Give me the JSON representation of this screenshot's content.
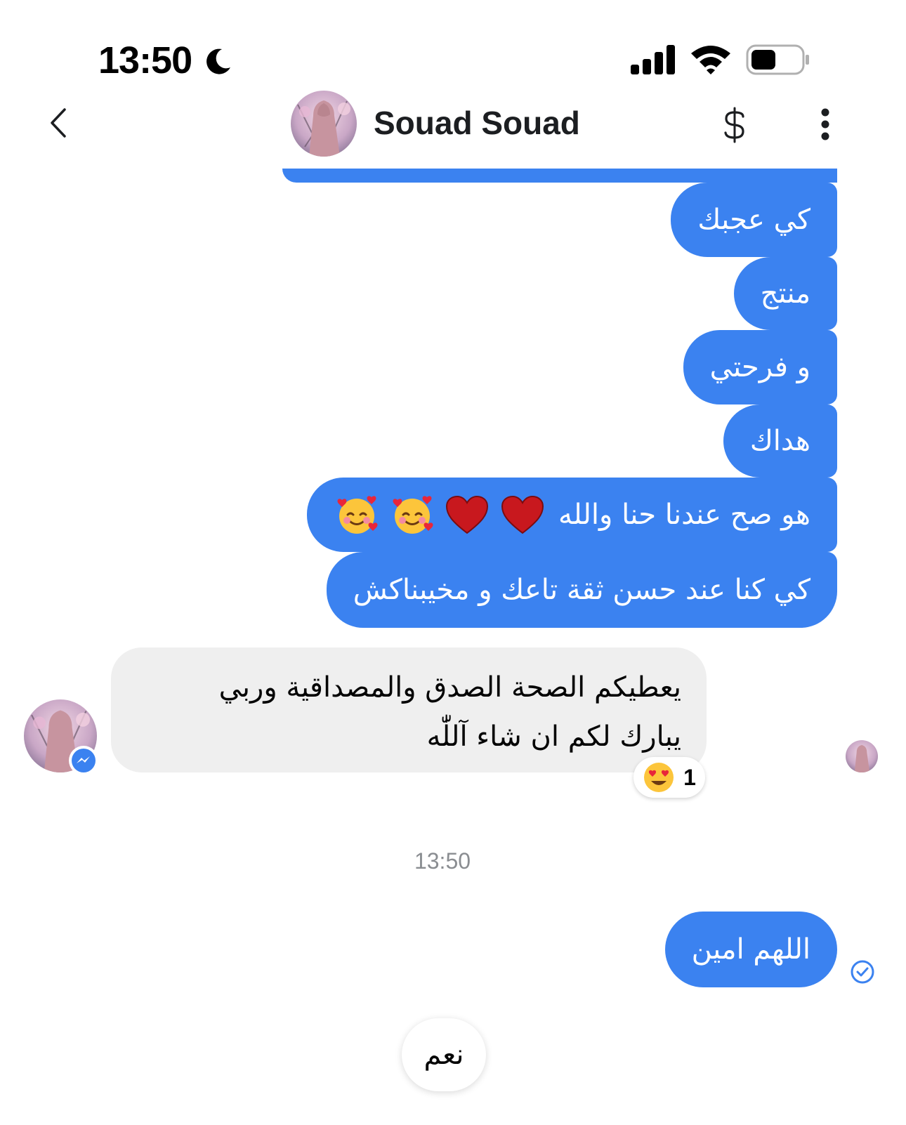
{
  "status_bar": {
    "time": "13:50",
    "icons": [
      "moon-icon",
      "signal-icon",
      "wifi-icon",
      "battery-icon"
    ]
  },
  "header": {
    "contact_name": "Souad Souad",
    "icons": [
      "back-chevron-icon",
      "contact-avatar",
      "dollar-icon",
      "more-vertical-icon"
    ]
  },
  "messages": {
    "outgoing": [
      "كي عجبك",
      "منتج",
      "و فرحتي",
      "هداك",
      "هو صح عندنا حنا والله",
      "كي كنا عند حسن ثقة تاعك و مخيبناكش"
    ],
    "outgoing_emojis": [
      "heart-emoji",
      "heart-emoji",
      "smiling-face-with-hearts-emoji",
      "smiling-face-with-hearts-emoji"
    ],
    "incoming": {
      "line1": "يعطيكم الصحة الصدق والمصداقية وربي",
      "line2": "يبارك لكم ان شاء آللّٰه",
      "reaction": {
        "emoji": "heart-eyes-emoji",
        "count": "1"
      }
    },
    "timestamp": "13:50",
    "last_outgoing": "اللهم امين"
  },
  "quick_reply": {
    "label": "نعم"
  },
  "colors": {
    "outgoing_bubble": "#3b82f0",
    "incoming_bubble": "#efefef",
    "timestamp": "#8a8d91",
    "messenger_blue": "#3b82f0"
  }
}
